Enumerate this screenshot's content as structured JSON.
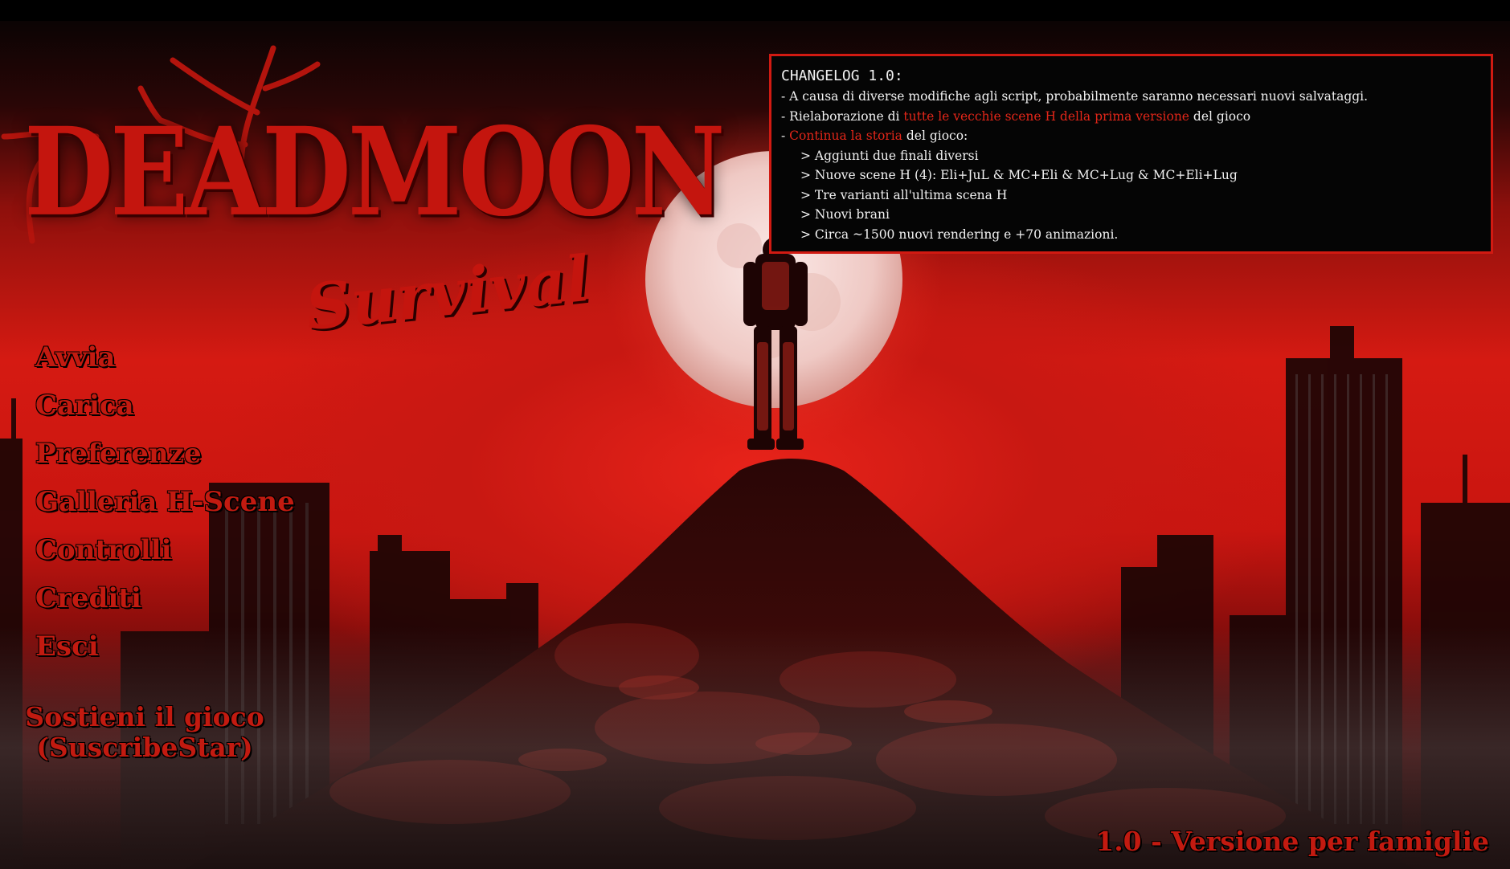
{
  "logo": {
    "title": "DEADMOON",
    "subtitle": "Survival"
  },
  "menu": {
    "items": [
      {
        "label": "Avvia"
      },
      {
        "label": "Carica"
      },
      {
        "label": "Preferenze"
      },
      {
        "label": "Galleria H-Scene"
      },
      {
        "label": "Controlli"
      },
      {
        "label": "Crediti"
      },
      {
        "label": "Esci"
      }
    ],
    "support_line1": "Sostieni il gioco",
    "support_line2": "(SuscribeStar)"
  },
  "version": "1.0 - Versione per famiglie",
  "changelog": {
    "title": "CHANGELOG 1.0:",
    "line1": "- A causa di diverse modifiche agli script, probabilmente saranno necessari nuovi salvataggi.",
    "line2_pre": "- Rielaborazione di ",
    "line2_hl": "tutte le vecchie scene H della prima versione",
    "line2_post": " del gioco",
    "line3_pre": "- ",
    "line3_hl": "Continua la storia",
    "line3_post": " del gioco:",
    "subitems": [
      "> Aggiunti due finali diversi",
      "> Nuove scene H (4): Eli+JuL & MC+Eli & MC+Lug & MC+Eli+Lug",
      "> Tre varianti all'ultima scena H",
      "> Nuovi brani",
      "> Circa ~1500 nuovi rendering e +70 animazioni."
    ]
  },
  "colors": {
    "accent_red": "#c21a10",
    "highlight_red": "#e32619",
    "changelog_bg": "#050505",
    "moon": "#f3d9d6"
  }
}
